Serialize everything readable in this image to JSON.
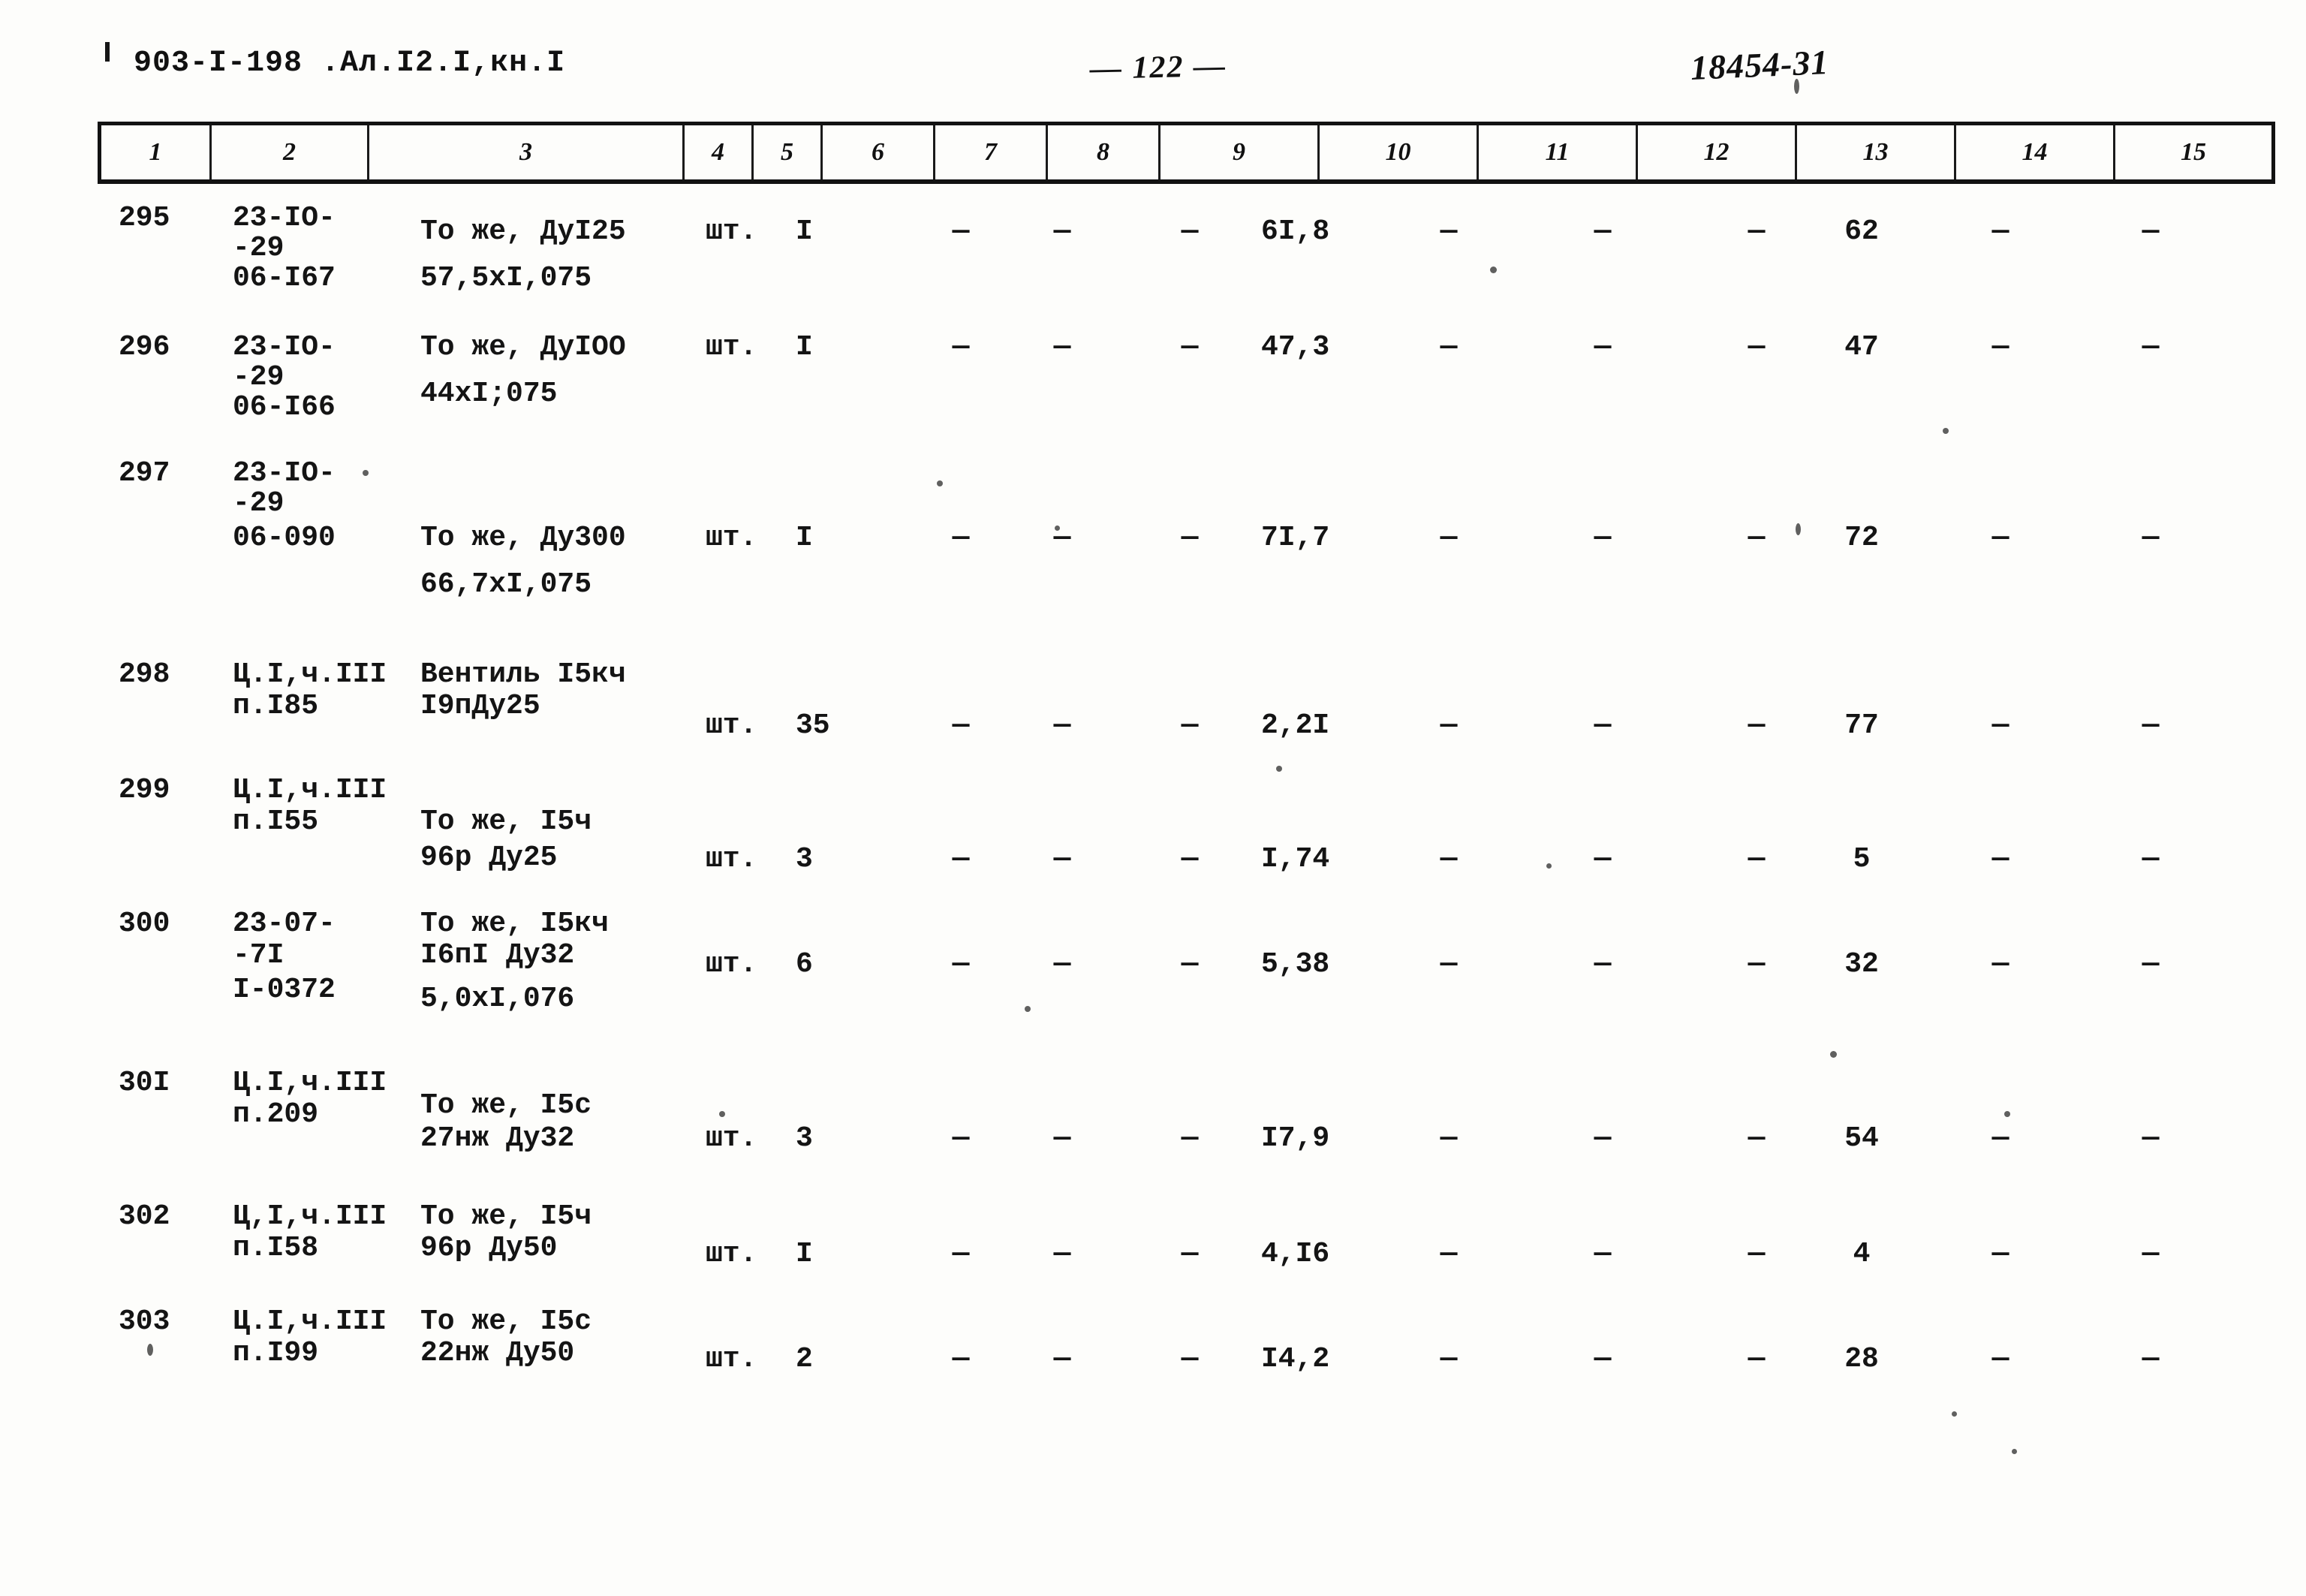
{
  "header": {
    "doc_code": "903-I-198 .Ал.I2.I,кн.I",
    "page_number": "— 122 —",
    "archive_number": "18454-31"
  },
  "table": {
    "column_headers": [
      "1",
      "2",
      "3",
      "4",
      "5",
      "6",
      "7",
      "8",
      "9",
      "10",
      "11",
      "12",
      "13",
      "14",
      "15"
    ],
    "dash": "—",
    "rows": [
      {
        "num": "295",
        "code_l1": "23-IO-",
        "code_l2": "-29",
        "code_l3": "06-I67",
        "name_l1": "То же, ДуI25",
        "name_l2": "57,5xI,075",
        "unit": "шт.",
        "qty": "I",
        "c6": "—",
        "c7": "—",
        "c8": "—",
        "c9": "6I,8",
        "c10": "—",
        "c11": "—",
        "c12": "—",
        "c13": "62",
        "c14": "—",
        "c15": "—"
      },
      {
        "num": "296",
        "code_l1": "23-IO-",
        "code_l2": "-29",
        "code_l3": "06-I66",
        "name_l1": "То же, ДуIOO",
        "name_l2": "44xI;075",
        "unit": "шт.",
        "qty": "I",
        "c6": "—",
        "c7": "—",
        "c8": "—",
        "c9": "47,3",
        "c10": "—",
        "c11": "—",
        "c12": "—",
        "c13": "47",
        "c14": "—",
        "c15": "—"
      },
      {
        "num": "297",
        "code_l1": "23-IO-",
        "code_l2": "-29",
        "code_l3": "06-090",
        "name_l1": "То же, Ду300",
        "name_l2": "66,7xI,075",
        "unit": "шт.",
        "qty": "I",
        "c6": "—",
        "c7": "—",
        "c8": "—",
        "c9": "7I,7",
        "c10": "—",
        "c11": "—",
        "c12": "—",
        "c13": "72",
        "c14": "—",
        "c15": "—"
      },
      {
        "num": "298",
        "code_l1": "Ц.I,ч.III",
        "code_l2": "п.I85",
        "code_l3": "",
        "name_l1": "Вентиль I5кч",
        "name_l2": "I9пДу25",
        "unit": "шт.",
        "qty": "35",
        "c6": "—",
        "c7": "—",
        "c8": "—",
        "c9": "2,2I",
        "c10": "—",
        "c11": "—",
        "c12": "—",
        "c13": "77",
        "c14": "—",
        "c15": "—"
      },
      {
        "num": "299",
        "code_l1": "Ц.I,ч.III",
        "code_l2": "п.I55",
        "code_l3": "",
        "name_l1": "То же, I5ч",
        "name_l2": "96р Ду25",
        "unit": "шт.",
        "qty": "3",
        "c6": "—",
        "c7": "—",
        "c8": "—",
        "c9": "I,74",
        "c10": "—",
        "c11": "—",
        "c12": "—",
        "c13": "5",
        "c14": "—",
        "c15": "—"
      },
      {
        "num": "300",
        "code_l1": "23-07-",
        "code_l2": "-7I",
        "code_l3": "I-0372",
        "name_l1": "То же, I5кч",
        "name_l2": "I6пI Ду32",
        "name_l3": "5,0xI,076",
        "unit": "шт.",
        "qty": "6",
        "c6": "—",
        "c7": "—",
        "c8": "—",
        "c9": "5,38",
        "c10": "—",
        "c11": "—",
        "c12": "—",
        "c13": "32",
        "c14": "—",
        "c15": "—"
      },
      {
        "num": "30I",
        "code_l1": "Ц.I,ч.III",
        "code_l2": "п.209",
        "code_l3": "",
        "name_l1": "То же, I5с",
        "name_l2": "27нж Ду32",
        "unit": "шт.",
        "qty": "3",
        "c6": "—",
        "c7": "—",
        "c8": "—",
        "c9": "I7,9",
        "c10": "—",
        "c11": "—",
        "c12": "—",
        "c13": "54",
        "c14": "—",
        "c15": "—"
      },
      {
        "num": "302",
        "code_l1": "Ц,I,ч.III",
        "code_l2": "п.I58",
        "code_l3": "",
        "name_l1": "То же, I5ч",
        "name_l2": "96р Ду50",
        "unit": "шт.",
        "qty": "I",
        "c6": "—",
        "c7": "—",
        "c8": "—",
        "c9": "4,I6",
        "c10": "—",
        "c11": "—",
        "c12": "—",
        "c13": "4",
        "c14": "—",
        "c15": "—"
      },
      {
        "num": "303",
        "code_l1": "Ц.I,ч.III",
        "code_l2": "п.I99",
        "code_l3": "",
        "name_l1": "То же, I5с",
        "name_l2": "22нж Ду50",
        "unit": "шт.",
        "qty": "2",
        "c6": "—",
        "c7": "—",
        "c8": "—",
        "c9": "I4,2",
        "c10": "—",
        "c11": "—",
        "c12": "—",
        "c13": "28",
        "c14": "—",
        "c15": "—"
      }
    ]
  }
}
